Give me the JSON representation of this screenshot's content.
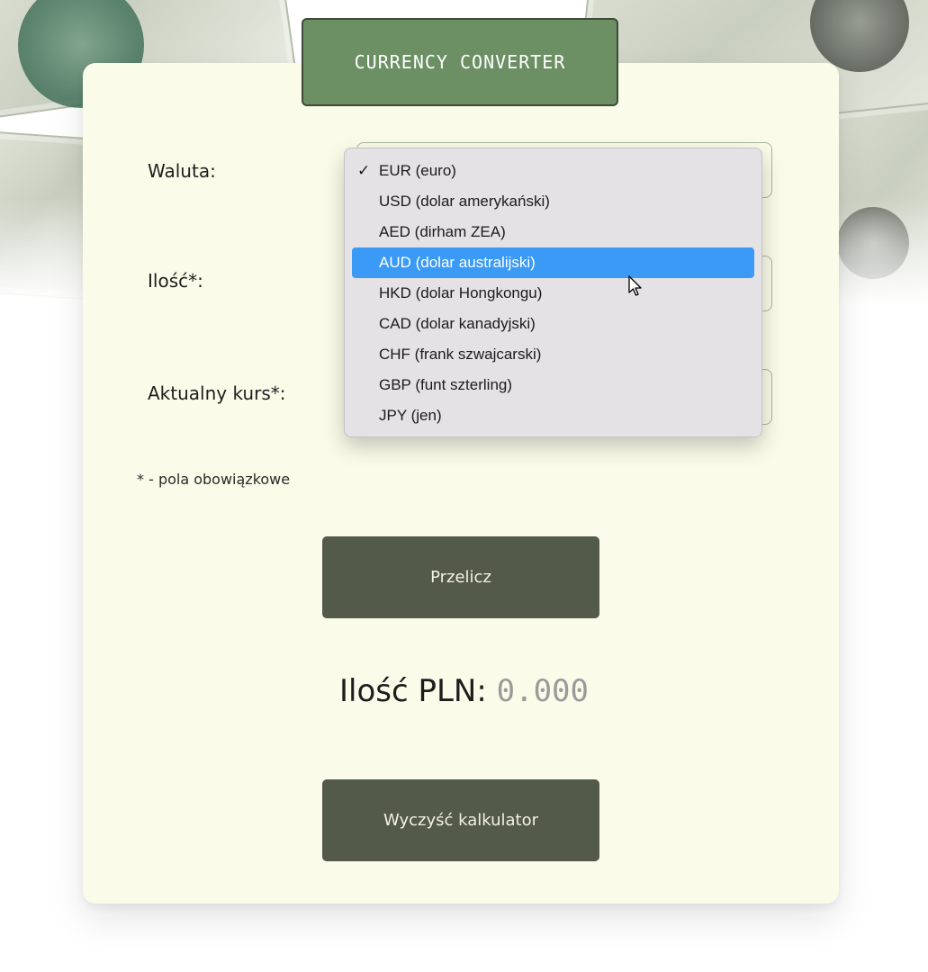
{
  "app": {
    "title": "CURRENCY CONVERTER"
  },
  "form": {
    "currency_label": "Waluta:",
    "amount_label": "Ilość*:",
    "rate_label": "Aktualny kurs*:",
    "required_note": "* - pola obowiązkowe",
    "currency_select": {
      "selected_value": "EUR (euro)",
      "highlighted_value": "AUD (dolar australijski)",
      "options": [
        "EUR (euro)",
        "USD (dolar amerykański)",
        "AED (dirham ZEA)",
        "AUD (dolar australijski)",
        "HKD (dolar Hongkongu)",
        "CAD (dolar kanadyjski)",
        "CHF (frank szwajcarski)",
        "GBP (funt szterling)",
        "JPY (jen)"
      ],
      "check_mark": "✓"
    }
  },
  "buttons": {
    "calculate_label": "Przelicz",
    "clear_label": "Wyczyść kalkulator"
  },
  "result": {
    "label": "Ilość PLN:",
    "value": "0.000"
  },
  "icons": {
    "checkmark": "checkmark-icon",
    "select_caret": "chevron-down-icon",
    "cursor": "mouse-pointer-icon"
  },
  "colors": {
    "card_background": "#fbfbe9",
    "title_tab": "#6c8f64",
    "button_background": "#545a4a",
    "dropdown_highlight": "#3a9af5",
    "result_value": "#9a9a9a"
  }
}
